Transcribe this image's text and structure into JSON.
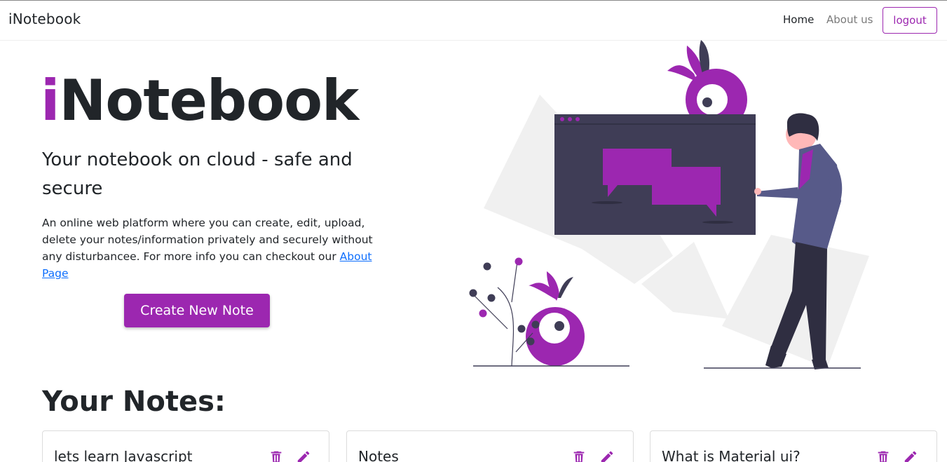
{
  "navbar": {
    "brand": "iNotebook",
    "links": {
      "home": "Home",
      "about": "About us"
    },
    "logout_label": "logout"
  },
  "hero": {
    "title_first_letter": "i",
    "title_rest": "Notebook",
    "subtitle": "Your notebook on cloud - safe and secure",
    "description": "An online web platform where you can create, edit, upload, delete your notes/information privately and securely without any disturbancee. For more info you can checkout our ",
    "about_link": "About Page",
    "create_button": "Create New Note"
  },
  "notes_section": {
    "heading": "Your Notes:",
    "notes": [
      {
        "title": "lets learn Javascript"
      },
      {
        "title": "Notes"
      },
      {
        "title": "What is Material ui?"
      }
    ]
  },
  "colors": {
    "accent": "#9c27b0",
    "dark": "#3f3d56",
    "link": "#0d6efd"
  },
  "icons": {
    "delete": "trash-icon",
    "edit": "pencil-icon"
  }
}
